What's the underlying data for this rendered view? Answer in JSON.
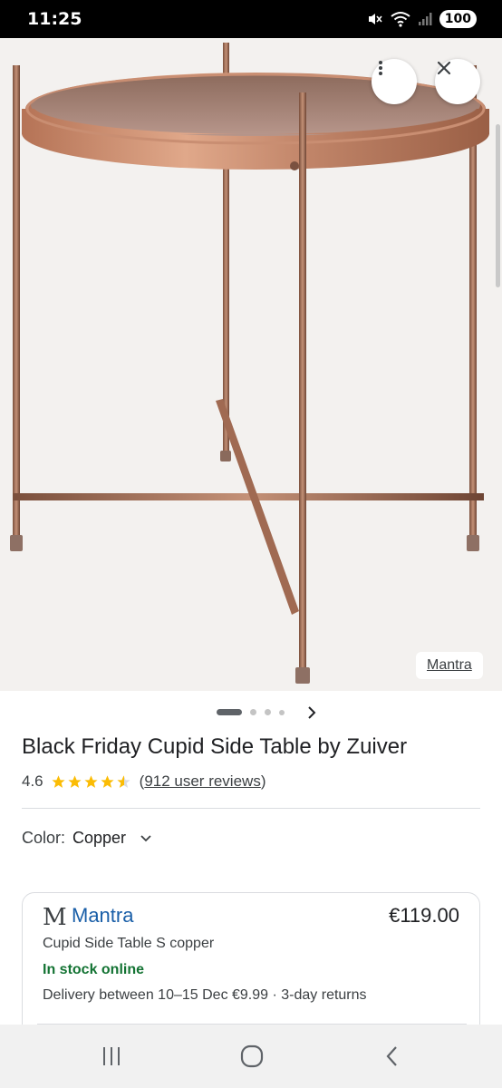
{
  "status_bar": {
    "time": "11:25",
    "battery": "100",
    "icons": [
      "mute-icon",
      "wifi-icon",
      "signal-icon"
    ]
  },
  "hero": {
    "image": "copper-side-table-photo",
    "more_icon": "more-vert-icon",
    "close_icon": "close-icon",
    "source_label": "Mantra"
  },
  "carousel": {
    "total_dots": 4,
    "active_index": 0,
    "next_icon": "chevron-right-icon"
  },
  "product": {
    "title": "Black Friday Cupid Side Table by Zuiver",
    "rating": "4.6",
    "stars_value": 4.6,
    "stars_max": 5,
    "reviews_open": "(",
    "reviews_link": "912 user reviews",
    "reviews_close": ")"
  },
  "color": {
    "label": "Color:",
    "value": "Copper",
    "dropdown_icon": "chevron-down-icon"
  },
  "offer": {
    "merchant_logo": "M",
    "merchant_name": "Mantra",
    "price": "€119.00",
    "product_name": "Cupid Side Table S copper",
    "stock": "In stock online",
    "delivery": "Delivery between 10–15 Dec €9.99 · 3-day returns"
  },
  "nav_bar": {
    "recents_icon": "recents-icon",
    "home_icon": "home-icon",
    "back_icon": "back-icon"
  },
  "colors": {
    "accent_link": "#1a5fa8",
    "stock_green": "#137333",
    "star_gold": "#fbbc04",
    "copper": "#b07a5e"
  }
}
